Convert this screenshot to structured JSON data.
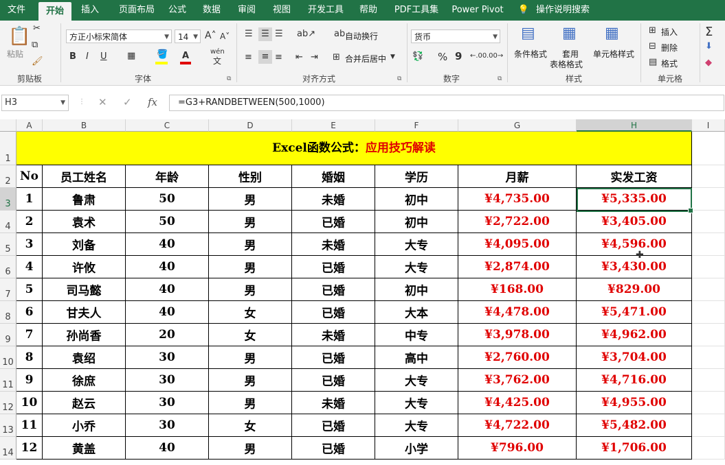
{
  "tabs": [
    "文件",
    "开始",
    "插入",
    "页面布局",
    "公式",
    "数据",
    "审阅",
    "视图",
    "开发工具",
    "帮助",
    "PDF工具集",
    "Power Pivot",
    "操作说明搜索"
  ],
  "ribbon": {
    "clipboard": {
      "paste": "粘贴",
      "label": "剪贴板"
    },
    "font": {
      "name": "方正小标宋简体",
      "size": "14",
      "label": "字体",
      "bold": "B",
      "italic": "I",
      "underline": "U",
      "wen": "wén",
      "wen2": "文"
    },
    "align": {
      "wrap": "自动换行",
      "merge": "合并后居中",
      "label": "对齐方式"
    },
    "number": {
      "format": "货币",
      "label": "数字",
      "pct": "%",
      "comma": "9"
    },
    "styles": {
      "cond": "条件格式",
      "table1": "套用",
      "table2": "表格格式",
      "cell": "单元格样式",
      "label": "样式"
    },
    "cells": {
      "insert": "插入",
      "delete": "删除",
      "format": "格式",
      "label": "单元格"
    }
  },
  "formula_bar": {
    "name_box": "H3",
    "cancel": "✕",
    "enter": "✓",
    "fx": "fx",
    "formula": "=G3+RANDBETWEEN(500,1000)"
  },
  "columns": [
    "A",
    "B",
    "C",
    "D",
    "E",
    "F",
    "G",
    "H",
    "I"
  ],
  "rows": [
    "1",
    "2",
    "3",
    "4",
    "5",
    "6",
    "7",
    "8",
    "9",
    "10",
    "11",
    "12",
    "13",
    "14"
  ],
  "sheet": {
    "title_black": "Excel函数公式：",
    "title_red": "应用技巧解读",
    "headers": [
      "No",
      "员工姓名",
      "年龄",
      "性别",
      "婚姻",
      "学历",
      "月薪",
      "实发工资"
    ],
    "data": [
      [
        "1",
        "鲁肃",
        "50",
        "男",
        "未婚",
        "初中",
        "¥4,735.00",
        "¥5,335.00"
      ],
      [
        "2",
        "袁术",
        "50",
        "男",
        "已婚",
        "初中",
        "¥2,722.00",
        "¥3,405.00"
      ],
      [
        "3",
        "刘备",
        "40",
        "男",
        "未婚",
        "大专",
        "¥4,095.00",
        "¥4,596.00"
      ],
      [
        "4",
        "许攸",
        "40",
        "男",
        "已婚",
        "大专",
        "¥2,874.00",
        "¥3,430.00"
      ],
      [
        "5",
        "司马懿",
        "40",
        "男",
        "已婚",
        "初中",
        "¥168.00",
        "¥829.00"
      ],
      [
        "6",
        "甘夫人",
        "40",
        "女",
        "已婚",
        "大本",
        "¥4,478.00",
        "¥5,471.00"
      ],
      [
        "7",
        "孙尚香",
        "20",
        "女",
        "未婚",
        "中专",
        "¥3,978.00",
        "¥4,962.00"
      ],
      [
        "8",
        "袁绍",
        "30",
        "男",
        "已婚",
        "高中",
        "¥2,760.00",
        "¥3,704.00"
      ],
      [
        "9",
        "徐庶",
        "30",
        "男",
        "已婚",
        "大专",
        "¥3,762.00",
        "¥4,716.00"
      ],
      [
        "10",
        "赵云",
        "30",
        "男",
        "未婚",
        "大专",
        "¥4,425.00",
        "¥4,955.00"
      ],
      [
        "11",
        "小乔",
        "30",
        "女",
        "已婚",
        "大专",
        "¥4,722.00",
        "¥5,482.00"
      ],
      [
        "12",
        "黄盖",
        "40",
        "男",
        "已婚",
        "小学",
        "¥796.00",
        "¥1,706.00"
      ]
    ]
  },
  "colors": {
    "accent": "#217346",
    "title_bg": "#ffff00",
    "money": "#e00000"
  }
}
